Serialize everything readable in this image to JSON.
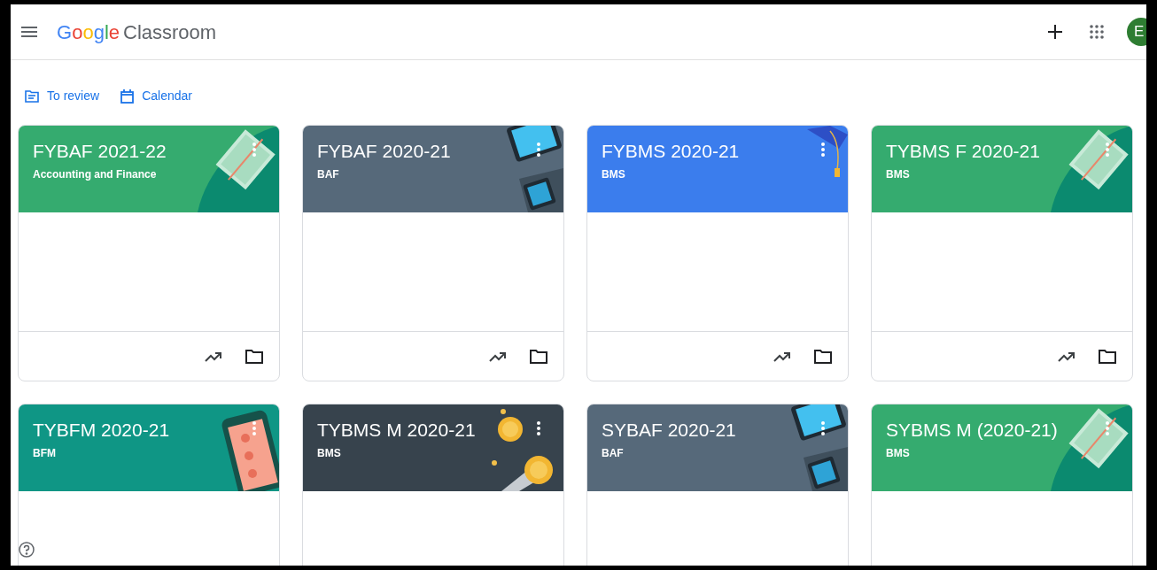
{
  "header": {
    "logo": {
      "brand": "Google",
      "product": "Classroom"
    },
    "avatar": {
      "initial": "E"
    }
  },
  "nav": [
    {
      "kind": "review",
      "label": "To review"
    },
    {
      "kind": "calendar",
      "label": "Calendar"
    }
  ],
  "classes": [
    {
      "title": "FYBAF 2021-22",
      "subtitle": "Accounting and Finance",
      "color": "#35ab6f",
      "kind": "book"
    },
    {
      "title": "FYBAF 2020-21",
      "subtitle": "BAF",
      "color": "#56697a",
      "kind": "devices"
    },
    {
      "title": "FYBMS 2020-21",
      "subtitle": "BMS",
      "color": "#3b7ded",
      "kind": "graduation"
    },
    {
      "title": "TYBMS F 2020-21",
      "subtitle": "BMS",
      "color": "#35ab6f",
      "kind": "book"
    },
    {
      "title": "TYBFM 2020-21",
      "subtitle": "BFM",
      "color": "#0f9685",
      "kind": "phone"
    },
    {
      "title": "TYBMS M 2020-21",
      "subtitle": "BMS",
      "color": "#37434d",
      "kind": "coins"
    },
    {
      "title": "SYBAF 2020-21",
      "subtitle": "BAF",
      "color": "#56697a",
      "kind": "devices"
    },
    {
      "title": "SYBMS M (2020-21)",
      "subtitle": "BMS",
      "color": "#35ab6f",
      "kind": "book"
    }
  ]
}
